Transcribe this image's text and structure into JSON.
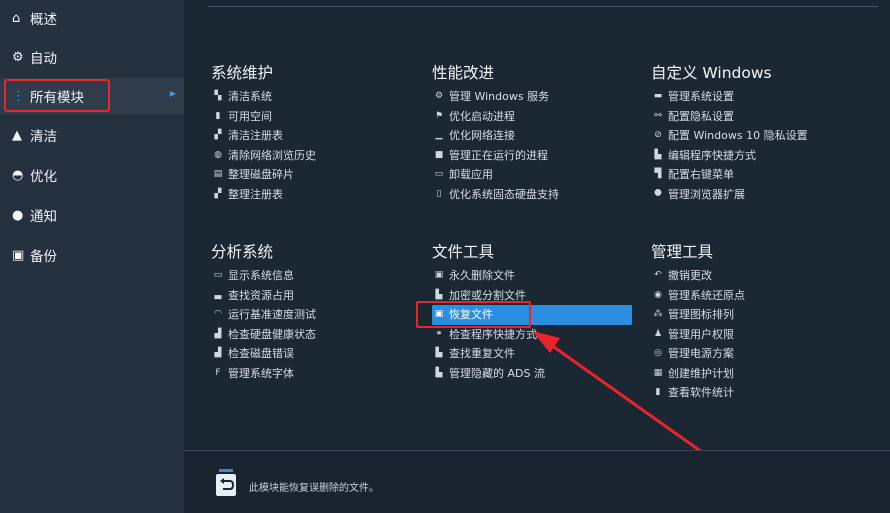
{
  "sidebar": {
    "items": [
      {
        "icon": "home-icon",
        "glyph": "⌂",
        "label": "概述"
      },
      {
        "icon": "gears-icon",
        "glyph": "⚙",
        "label": "自动"
      },
      {
        "icon": "grid-icon",
        "glyph": "⋮⋮",
        "label": "所有模块"
      },
      {
        "icon": "broom-icon",
        "glyph": "▲",
        "label": "清洁"
      },
      {
        "icon": "speedometer-icon",
        "glyph": "◓",
        "label": "优化"
      },
      {
        "icon": "info-icon",
        "glyph": "●",
        "label": "通知"
      },
      {
        "icon": "backup-icon",
        "glyph": "▣",
        "label": "备份"
      }
    ],
    "active_index": 2
  },
  "groups": [
    {
      "title": "系统维护",
      "items": [
        "清洁系统",
        "可用空间",
        "清洁注册表",
        "清除网络浏览历史",
        "整理磁盘碎片",
        "整理注册表"
      ]
    },
    {
      "title": "性能改进",
      "items": [
        "管理 Windows 服务",
        "优化启动进程",
        "优化网络连接",
        "管理正在运行的进程",
        "卸载应用",
        "优化系统固态硬盘支持"
      ]
    },
    {
      "title": "自定义 Windows",
      "items": [
        "管理系统设置",
        "配置隐私设置",
        "配置 Windows 10 隐私设置",
        "编辑程序快捷方式",
        "配置右键菜单",
        "管理浏览器扩展"
      ]
    },
    {
      "title": "分析系统",
      "items": [
        "显示系统信息",
        "查找资源占用",
        "运行基准速度测试",
        "检查硬盘健康状态",
        "检查磁盘错误",
        "管理系统字体"
      ]
    },
    {
      "title": "文件工具",
      "items": [
        "永久删除文件",
        "加密或分割文件",
        "恢复文件",
        "检查程序快捷方式",
        "查找重复文件",
        "管理隐藏的 ADS 流"
      ]
    },
    {
      "title": "管理工具",
      "items": [
        "撤销更改",
        "管理系统还原点",
        "管理图标排列",
        "管理用户权限",
        "管理电源方案",
        "创建维护计划",
        "查看软件统计"
      ]
    }
  ],
  "footer": {
    "text": "此模块能恢复误删除的文件。"
  },
  "accent": "#2b8ee0",
  "highlight_color": "#e8252b"
}
